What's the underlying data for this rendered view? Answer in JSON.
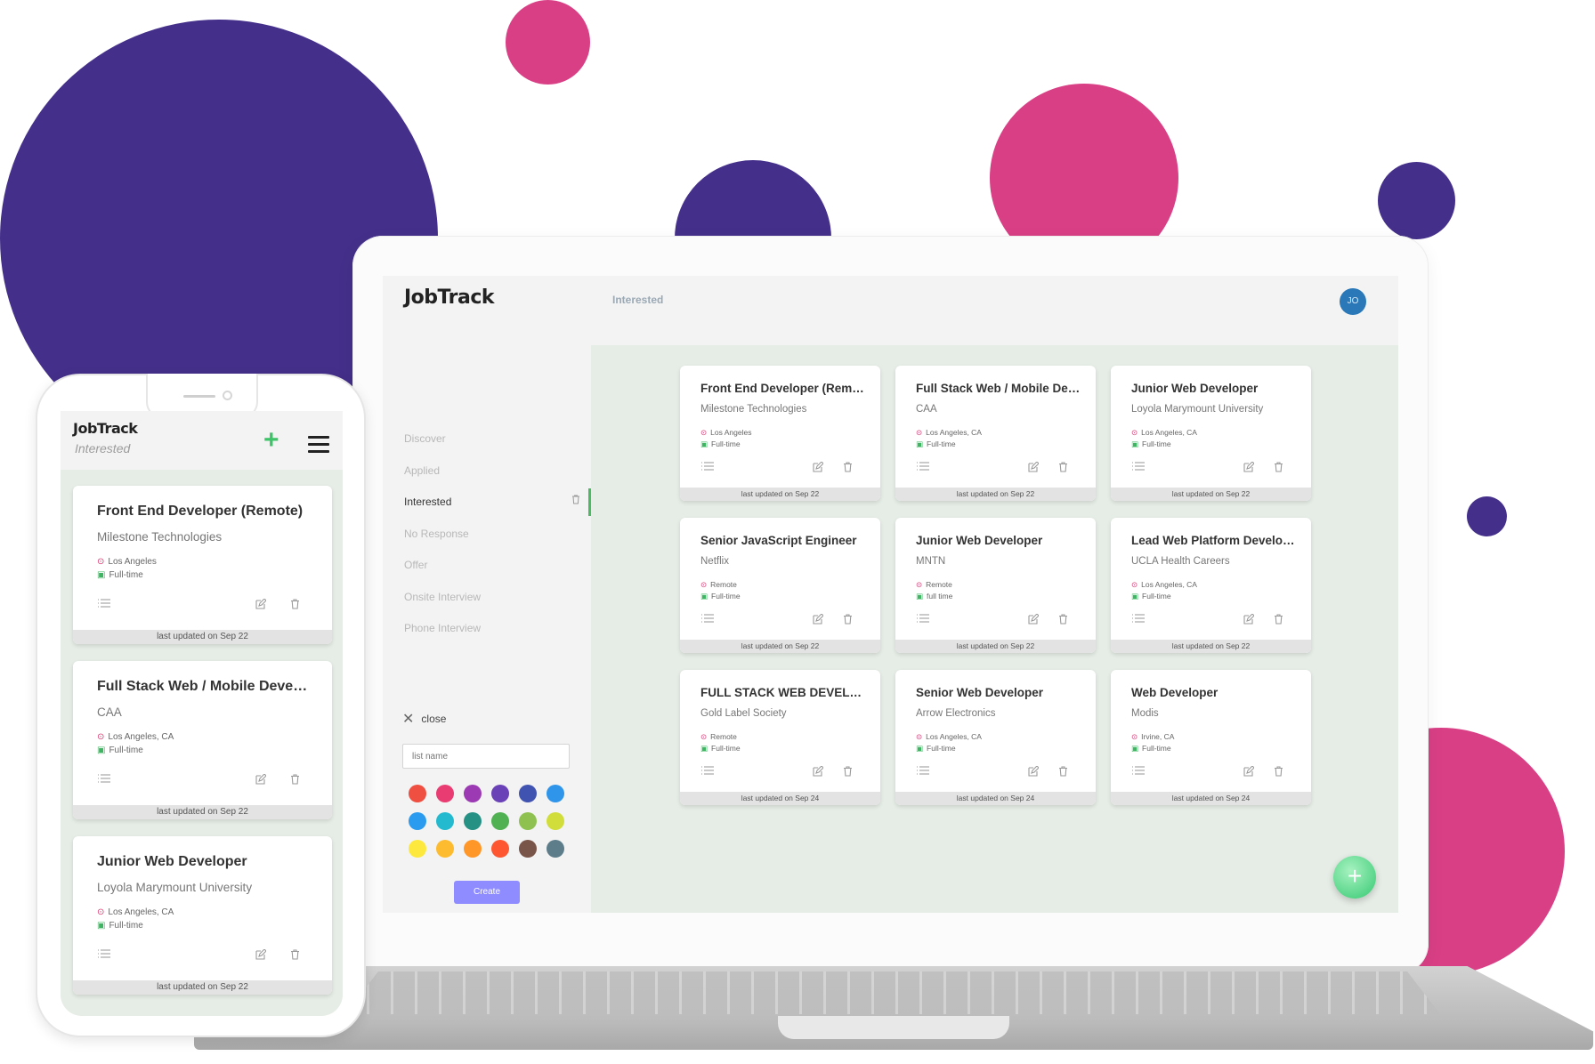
{
  "colors": {
    "purple": "#442f8a",
    "pink": "#d93f85",
    "active_bar": "#4cba62",
    "create_button": "#8f8cff",
    "avatar": "#2a78b8",
    "fab": "#36c972"
  },
  "desktop": {
    "logo": "JobTrack",
    "header_title": "Interested",
    "avatar_initials": "JO",
    "nav": [
      {
        "label": "Discover",
        "active": false
      },
      {
        "label": "Applied",
        "active": false
      },
      {
        "label": "Interested",
        "active": true
      },
      {
        "label": "No Response",
        "active": false
      },
      {
        "label": "Offer",
        "active": false
      },
      {
        "label": "Onsite Interview",
        "active": false
      },
      {
        "label": "Phone Interview",
        "active": false
      }
    ],
    "list_form": {
      "close_label": "close",
      "input_placeholder": "list name",
      "create_label": "Create",
      "swatches": [
        "#ef4f40",
        "#e93c72",
        "#9c3ab4",
        "#6a41b6",
        "#4153b0",
        "#2f95ea",
        "#2b9bef",
        "#23bad0",
        "#259185",
        "#4fb152",
        "#8ec150",
        "#d1dd3a",
        "#fde93d",
        "#fdbb2f",
        "#ff9628",
        "#fd5630",
        "#795448",
        "#5e7d8b"
      ]
    },
    "cards": [
      {
        "title": "Front End Developer (Remote)",
        "company": "Milestone Technologies",
        "location": "Los Angeles",
        "type": "Full-time",
        "updated": "last updated on Sep 22"
      },
      {
        "title": "Full Stack Web / Mobile Developer",
        "company": "CAA",
        "location": "Los Angeles, CA",
        "type": "Full-time",
        "updated": "last updated on Sep 22"
      },
      {
        "title": "Junior Web Developer",
        "company": "Loyola Marymount University",
        "location": "Los Angeles, CA",
        "type": "Full-time",
        "updated": "last updated on Sep 22"
      },
      {
        "title": "Senior JavaScript Engineer",
        "company": "Netflix",
        "location": "Remote",
        "type": "Full-time",
        "updated": "last updated on Sep 22"
      },
      {
        "title": "Junior Web Developer",
        "company": "MNTN",
        "location": "Remote",
        "type": "full time",
        "updated": "last updated on Sep 22"
      },
      {
        "title": "Lead Web Platform Developer",
        "company": "UCLA Health Careers",
        "location": "Los Angeles, CA",
        "type": "Full-time",
        "updated": "last updated on Sep 22"
      },
      {
        "title": "FULL STACK WEB DEVELOPER",
        "company": "Gold Label Society",
        "location": "Remote",
        "type": "Full-time",
        "updated": "last updated on Sep 24"
      },
      {
        "title": "Senior Web Developer",
        "company": "Arrow Electronics",
        "location": "Los Angeles, CA",
        "type": "Full-time",
        "updated": "last updated on Sep 24"
      },
      {
        "title": "Web Developer",
        "company": "Modis",
        "location": "Irvine, CA",
        "type": "Full-time",
        "updated": "last updated on Sep 24"
      }
    ],
    "fab_label": "+"
  },
  "mobile": {
    "logo": "JobTrack",
    "subtitle": "Interested",
    "add_label": "+",
    "cards": [
      {
        "title": "Front End Developer (Remote)",
        "company": "Milestone Technologies",
        "location": "Los Angeles",
        "type": "Full-time",
        "updated": "last updated on Sep 22"
      },
      {
        "title": "Full Stack Web / Mobile Developer",
        "company": "CAA",
        "location": "Los Angeles, CA",
        "type": "Full-time",
        "updated": "last updated on Sep 22"
      },
      {
        "title": "Junior Web Developer",
        "company": "Loyola Marymount University",
        "location": "Los Angeles, CA",
        "type": "Full-time",
        "updated": "last updated on Sep 22"
      }
    ]
  }
}
